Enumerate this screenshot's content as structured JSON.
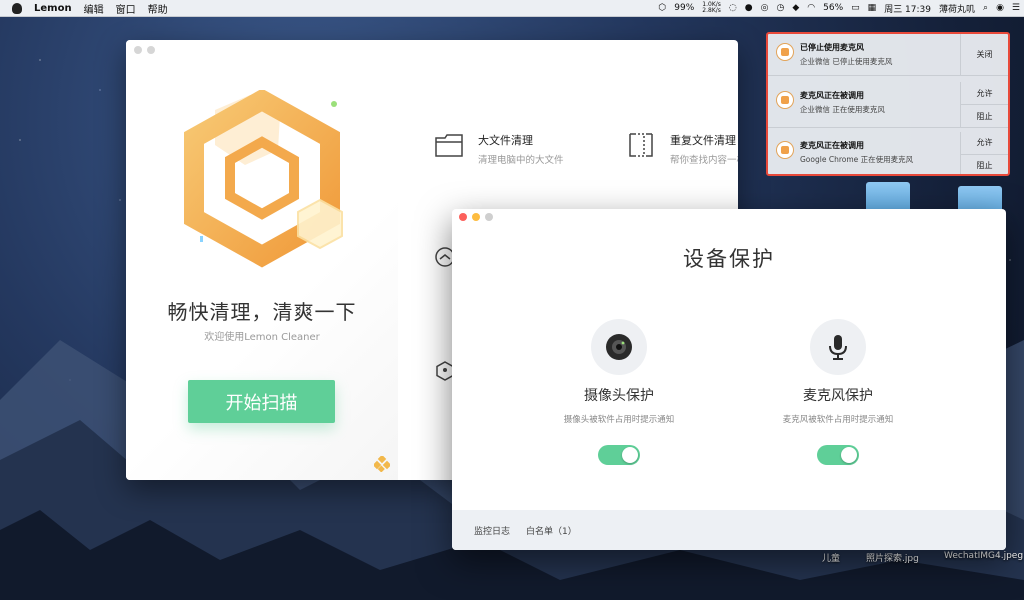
{
  "menubar": {
    "app_name": "Lemon",
    "menus": [
      "编辑",
      "窗口",
      "帮助"
    ],
    "battery_percent": "99%",
    "net_up": "1.0K/s",
    "net_down": "2.8K/s",
    "wifi_percent": "56%",
    "datetime": "周三 17:39",
    "username": "薄荷丸叽"
  },
  "lemon_window": {
    "headline": "畅快清理，清爽一下",
    "subline": "欢迎使用Lemon Cleaner",
    "scan_button": "开始扫描",
    "features": [
      {
        "title": "大文件清理",
        "desc": "清理电脑中的大文件",
        "icon": "folder-outline-icon"
      },
      {
        "title": "重复文件清理",
        "desc": "帮你查找内容一样的",
        "icon": "duplicate-file-icon"
      }
    ]
  },
  "device_window": {
    "title": "设备保护",
    "camera": {
      "title": "摄像头保护",
      "desc": "摄像头被软件占用时提示通知",
      "enabled": true
    },
    "mic": {
      "title": "麦克风保护",
      "desc": "麦克风被软件占用时提示通知",
      "enabled": true
    },
    "footer": {
      "log": "监控日志",
      "whitelist": "白名单（1）"
    }
  },
  "notifications": [
    {
      "title": "已停止使用麦克风",
      "body": "企业微信 已停止使用麦克风",
      "actions": [
        "关闭"
      ]
    },
    {
      "title": "麦克风正在被调用",
      "body": "企业微信 正在使用麦克风",
      "actions": [
        "允许",
        "阻止"
      ]
    },
    {
      "title": "麦克风正在被调用",
      "body": "Google Chrome 正在使用麦克风",
      "actions": [
        "允许",
        "阻止"
      ]
    }
  ],
  "desktop": {
    "labels": [
      "儿童",
      "照片探索.jpg",
      "WechatIMG4.jpeg"
    ]
  },
  "colors": {
    "accent_green": "#5fcf98",
    "lemon_orange": "#f0a14a",
    "highlight_red": "#e8493a"
  }
}
